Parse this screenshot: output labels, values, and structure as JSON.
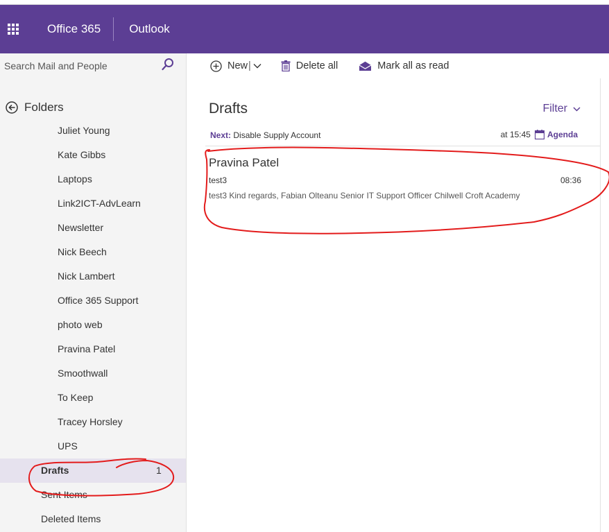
{
  "suite": {
    "title": "Office 365",
    "app": "Outlook"
  },
  "search": {
    "placeholder": "Search Mail and People"
  },
  "nav": {
    "folders_label": "Folders",
    "folders": [
      {
        "label": "Juliet Young"
      },
      {
        "label": "Kate Gibbs"
      },
      {
        "label": "Laptops"
      },
      {
        "label": "Link2ICT-AdvLearn"
      },
      {
        "label": "Newsletter"
      },
      {
        "label": "Nick Beech"
      },
      {
        "label": "Nick Lambert"
      },
      {
        "label": "Office 365 Support"
      },
      {
        "label": "photo web"
      },
      {
        "label": "Pravina Patel"
      },
      {
        "label": "Smoothwall"
      },
      {
        "label": "To Keep"
      },
      {
        "label": "Tracey Horsley"
      },
      {
        "label": "UPS"
      },
      {
        "label": "Drafts",
        "count": "1"
      },
      {
        "label": "Sent Items"
      },
      {
        "label": "Deleted Items"
      }
    ]
  },
  "toolbar": {
    "new_label": "New",
    "delete_all_label": "Delete all",
    "mark_read_label": "Mark all as read"
  },
  "list": {
    "title": "Drafts",
    "filter_label": "Filter",
    "next_label": "Next:",
    "next_event": "Disable Supply Account",
    "next_time": "at 15:45",
    "agenda_label": "Agenda",
    "messages": [
      {
        "from": "Pravina Patel",
        "subject": "test3",
        "time": "08:36",
        "preview": "test3   Kind regards,  Fabian Olteanu Senior IT Support Officer Chilwell Croft Academy"
      }
    ]
  },
  "colors": {
    "brand": "#5c3e94",
    "annotation": "#e31b1b",
    "selected_bg": "#e6e2ee"
  }
}
